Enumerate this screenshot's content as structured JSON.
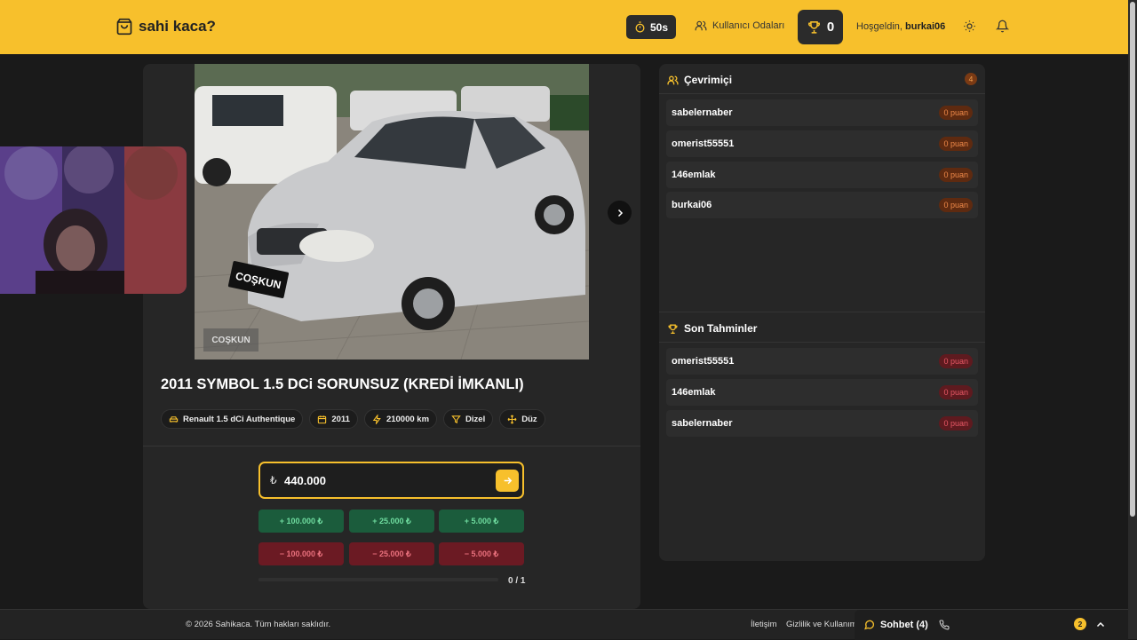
{
  "header": {
    "logo_text": "sahi kaca?",
    "timer": "50s",
    "rooms_label": "Kullanıcı Odaları",
    "score": "0",
    "welcome_prefix": "Hoşgeldin,",
    "username": "burkai06",
    "accent": "#f7c02c"
  },
  "listing": {
    "title": "2011 SYMBOL 1.5 DCi SORUNSUZ (KREDİ İMKANLI)",
    "plate_text": "COŞKUN",
    "watermark": "COŞKUN",
    "tags": [
      {
        "icon": "car-icon",
        "label": "Renault 1.5 dCi Authentique"
      },
      {
        "icon": "calendar-icon",
        "label": "2011"
      },
      {
        "icon": "gauge-icon",
        "label": "210000 km"
      },
      {
        "icon": "fuel-icon",
        "label": "Dizel"
      },
      {
        "icon": "gearbox-icon",
        "label": "Düz"
      }
    ]
  },
  "guess": {
    "currency": "₺",
    "value": "440.000",
    "plus_buttons": [
      "+ 100.000 ₺",
      "+ 25.000 ₺",
      "+ 5.000 ₺"
    ],
    "minus_buttons": [
      "− 100.000 ₺",
      "− 25.000 ₺",
      "− 5.000 ₺"
    ],
    "progress_text": "0 / 1",
    "progress_fraction": 0
  },
  "online": {
    "heading": "Çevrimiçi",
    "count": "4",
    "users": [
      {
        "name": "sabelernaber",
        "points": "0 puan"
      },
      {
        "name": "omerist55551",
        "points": "0 puan"
      },
      {
        "name": "146emlak",
        "points": "0 puan"
      },
      {
        "name": "burkai06",
        "points": "0 puan"
      }
    ]
  },
  "recent": {
    "heading": "Son Tahminler",
    "items": [
      {
        "name": "omerist55551",
        "points": "0 puan"
      },
      {
        "name": "146emlak",
        "points": "0 puan"
      },
      {
        "name": "sabelernaber",
        "points": "0 puan"
      }
    ]
  },
  "footer": {
    "copyright": "© 2026 Sahikaca. Tüm hakları saklıdır.",
    "contact": "İletişim",
    "privacy": "Gizlilik ve Kullanım",
    "chat_label": "Sohbet (4)",
    "chat_badge": "2"
  }
}
